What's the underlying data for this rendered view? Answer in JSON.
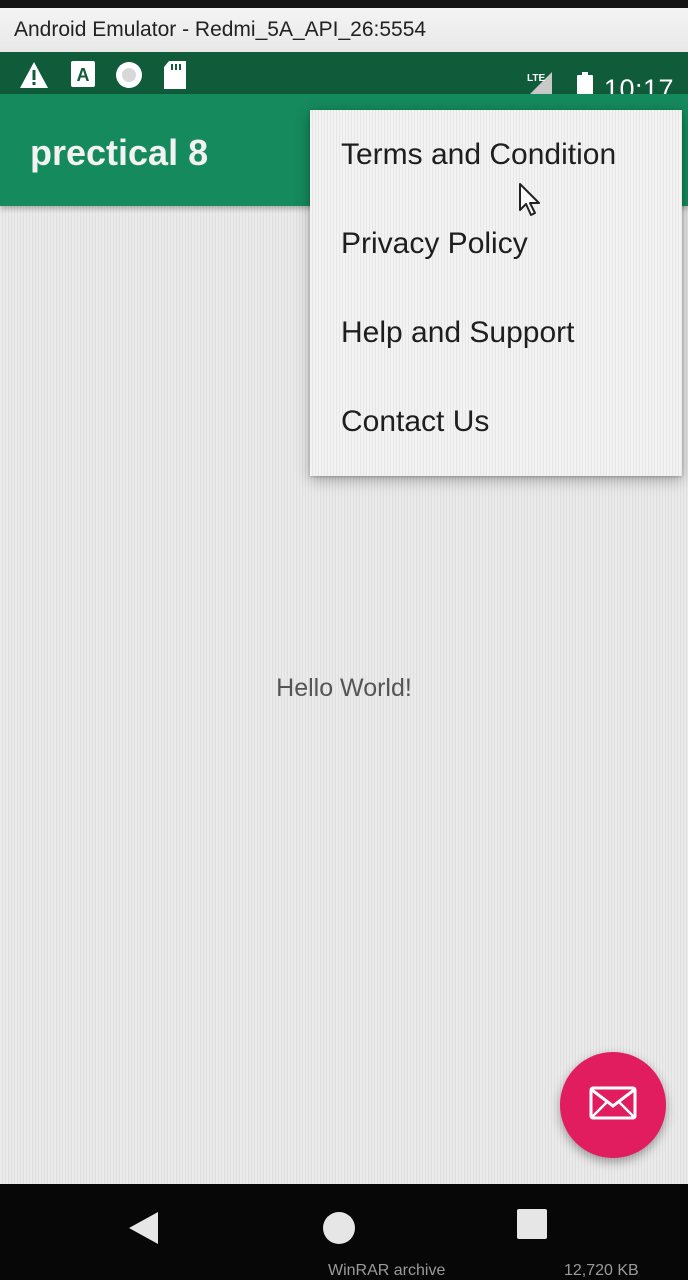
{
  "window": {
    "title": "Android Emulator - Redmi_5A_API_26:5554"
  },
  "status_bar": {
    "left_icons": [
      "warning-icon",
      "a-icon",
      "circle-icon",
      "sd-card-icon"
    ],
    "network_label": "LTE",
    "time": "10:17"
  },
  "app_bar": {
    "title": "prectical 8"
  },
  "menu": {
    "items": [
      {
        "label": "Terms and Condition"
      },
      {
        "label": "Privacy Policy"
      },
      {
        "label": "Help and Support"
      },
      {
        "label": "Contact Us"
      }
    ]
  },
  "content": {
    "text": "Hello World!"
  },
  "fab": {
    "icon": "mail-icon",
    "color": "#e11d5f"
  },
  "nav_bar": {
    "buttons": [
      "back-icon",
      "home-icon",
      "recents-icon"
    ]
  },
  "taskbar": {
    "item_type": "WinRAR archive",
    "size": "12,720 KB"
  },
  "colors": {
    "status_bar": "#0f5b3a",
    "app_bar": "#158a5d",
    "accent": "#e11d5f"
  }
}
